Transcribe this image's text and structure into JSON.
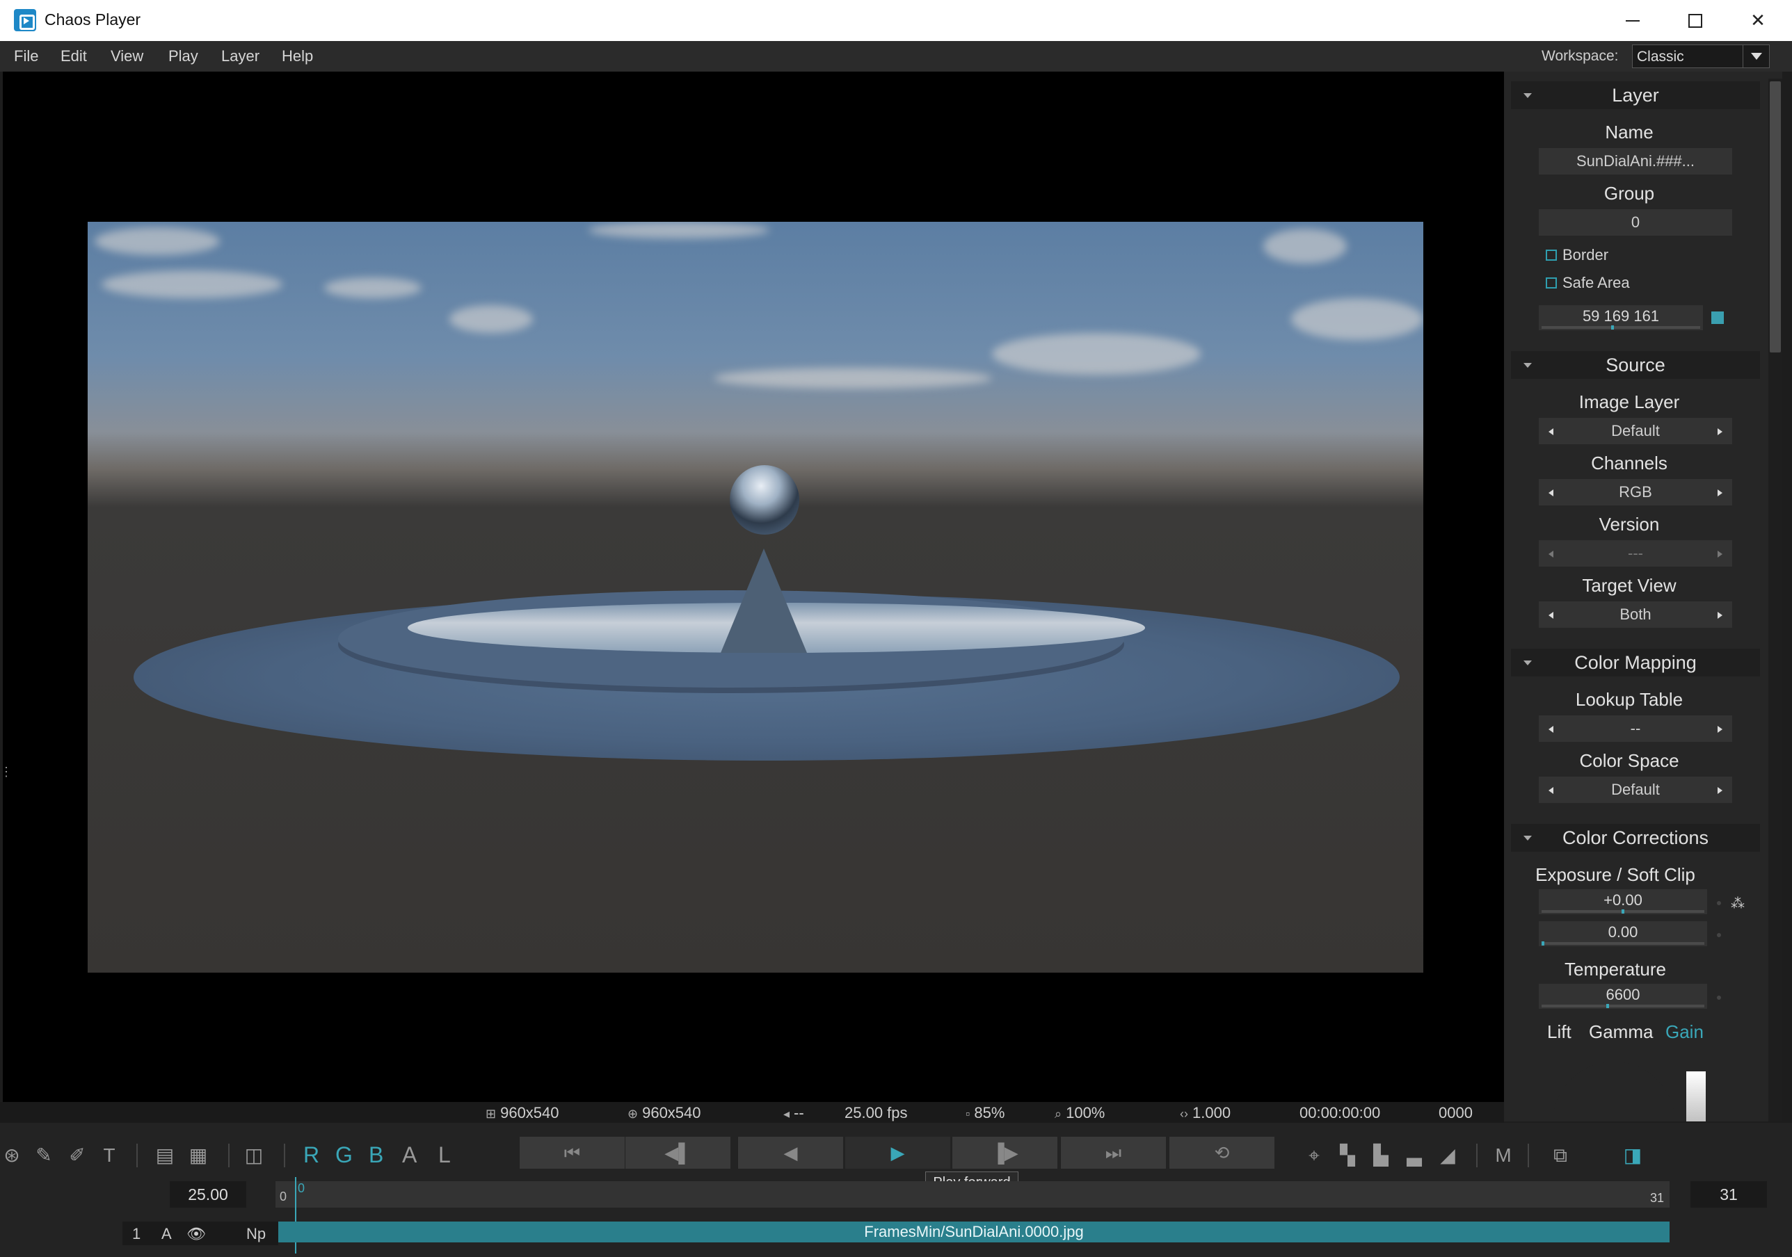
{
  "window": {
    "title": "Chaos Player"
  },
  "menu": {
    "items": [
      "File",
      "Edit",
      "View",
      "Play",
      "Layer",
      "Help"
    ]
  },
  "workspace": {
    "label": "Workspace:",
    "value": "Classic"
  },
  "panel": {
    "layer": {
      "header": "Layer",
      "name_label": "Name",
      "name_value": "SunDialAni.###...",
      "group_label": "Group",
      "group_value": "0",
      "border_label": "Border",
      "safe_area_label": "Safe Area",
      "color_value": "59 169 161"
    },
    "source": {
      "header": "Source",
      "image_layer_label": "Image Layer",
      "image_layer_value": "Default",
      "channels_label": "Channels",
      "channels_value": "RGB",
      "version_label": "Version",
      "version_value": "---",
      "target_view_label": "Target View",
      "target_view_value": "Both"
    },
    "color_mapping": {
      "header": "Color Mapping",
      "lut_label": "Lookup Table",
      "lut_value": "--",
      "color_space_label": "Color Space",
      "color_space_value": "Default"
    },
    "color_corrections": {
      "header": "Color Corrections",
      "exposure_label": "Exposure / Soft Clip",
      "exposure_value": "+0.00",
      "softclip_value": "0.00",
      "temperature_label": "Temperature",
      "temperature_value": "6600",
      "lift_label": "Lift",
      "gamma_label": "Gamma",
      "gain_label": "Gain"
    }
  },
  "status": {
    "resolution": "960x540",
    "data_window": "960x540",
    "audio": "--",
    "fps": "25.00 fps",
    "memory": "85%",
    "zoom": "100%",
    "pixel_aspect": "1.000",
    "timecode": "00:00:00:00",
    "frame": "0000"
  },
  "toolbar": {
    "channels": [
      "R",
      "G",
      "B",
      "A",
      "L"
    ],
    "monitor_label": "M",
    "tooltip": "Play forward",
    "fps_value": "25.00",
    "timeline_start": "0",
    "timeline_current": "0",
    "timeline_end": "31",
    "end_frame": "31",
    "layer_index": "1",
    "layer_a": "A",
    "layer_np": "Np",
    "layer_file": "FramesMin/SunDialAni.0000.jpg"
  },
  "colors": {
    "accent": "#3aa7b8",
    "layer_bar": "#2a7f8c",
    "panel_bg": "#262626"
  }
}
